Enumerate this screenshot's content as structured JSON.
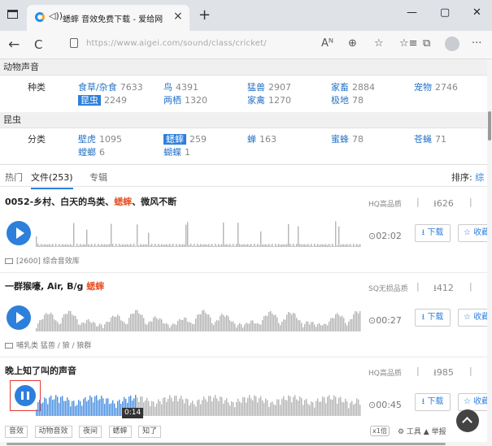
{
  "browser": {
    "tab_title": "蟋蟀 音效免费下载 - 爱给网",
    "tab_audio_icon": "speaker-icon",
    "tab_close": "×",
    "new_tab": "+",
    "window_controls": {
      "minimize": "—",
      "maximize": "▢",
      "close": "✕"
    },
    "nav": {
      "back": "←",
      "refresh": "C"
    },
    "url": "https://www.aigei.com/sound/class/cricket/",
    "toolbar": {
      "read_aloud": "Aᴺ",
      "zoom": "⊕",
      "favorite": "☆",
      "favorites_list": "☆≡",
      "collections": "⧉",
      "more": "···"
    }
  },
  "filters": {
    "section1_title": "动物声音",
    "section1_label": "种类",
    "section1_row1": [
      {
        "name": "食草/杂食",
        "count": "7633"
      },
      {
        "name": "鸟",
        "count": "4391"
      },
      {
        "name": "猛兽",
        "count": "2907"
      },
      {
        "name": "家畜",
        "count": "2884"
      },
      {
        "name": "宠物",
        "count": "2746"
      }
    ],
    "section1_row2": [
      {
        "name": "昆虫",
        "count": "2249",
        "selected": true
      },
      {
        "name": "两栖",
        "count": "1320"
      },
      {
        "name": "家禽",
        "count": "1270"
      },
      {
        "name": "极地",
        "count": "78"
      }
    ],
    "section2_title": "昆虫",
    "section2_label": "分类",
    "section2_row1": [
      {
        "name": "壁虎",
        "count": "1095"
      },
      {
        "name": "蟋蟀",
        "count": "259",
        "selected": true
      },
      {
        "name": "蝉",
        "count": "163"
      },
      {
        "name": "蜜蜂",
        "count": "78"
      },
      {
        "name": "苍蝇",
        "count": "71"
      }
    ],
    "section2_row2": [
      {
        "name": "螳螂",
        "count": "6"
      },
      {
        "name": "蝴蝶",
        "count": "1"
      }
    ]
  },
  "subtabs": {
    "hot": "热门",
    "files": "文件(253)",
    "albums": "专辑",
    "sort_label": "排序:",
    "sort_value": "综"
  },
  "items": [
    {
      "title_pre": "0052-乡村、白天的鸟类、",
      "title_hl": "蟋蟀",
      "title_post": "、微风不断",
      "quality": "HQ高品质",
      "sep": "|",
      "downloads": "⭳626",
      "duration": "⊙02:02",
      "download_label": "⭳ 下载",
      "fav_label": "☆ 收藏",
      "meta": "[2600] 综合音效库"
    },
    {
      "title_pre": "一群猴嚎, Air, B/g ",
      "title_hl": "蟋蟀",
      "title_post": "",
      "quality": "SQ无损品质",
      "sep": "|",
      "downloads": "⭳412",
      "duration": "⊙00:27",
      "download_label": "⭳ 下载",
      "fav_label": "☆ 收藏",
      "meta": "哺乳类 猛兽 / 狼 / 狼群"
    },
    {
      "title_pre": "晚上知了叫的声音",
      "title_hl": "",
      "title_post": "",
      "quality": "HQ高品质",
      "sep": "|",
      "downloads": "⭳985",
      "duration": "⊙00:45",
      "download_label": "⭳ 下载",
      "fav_label": "☆ 收藏",
      "time_tip": "0:14",
      "progress": 0.31,
      "tags": [
        "音效",
        "动物音效",
        "夜间",
        "蟋蟀",
        "知了"
      ],
      "speed": "x1倍",
      "tools": "⚙ 工具 ▲ 举报"
    }
  ]
}
